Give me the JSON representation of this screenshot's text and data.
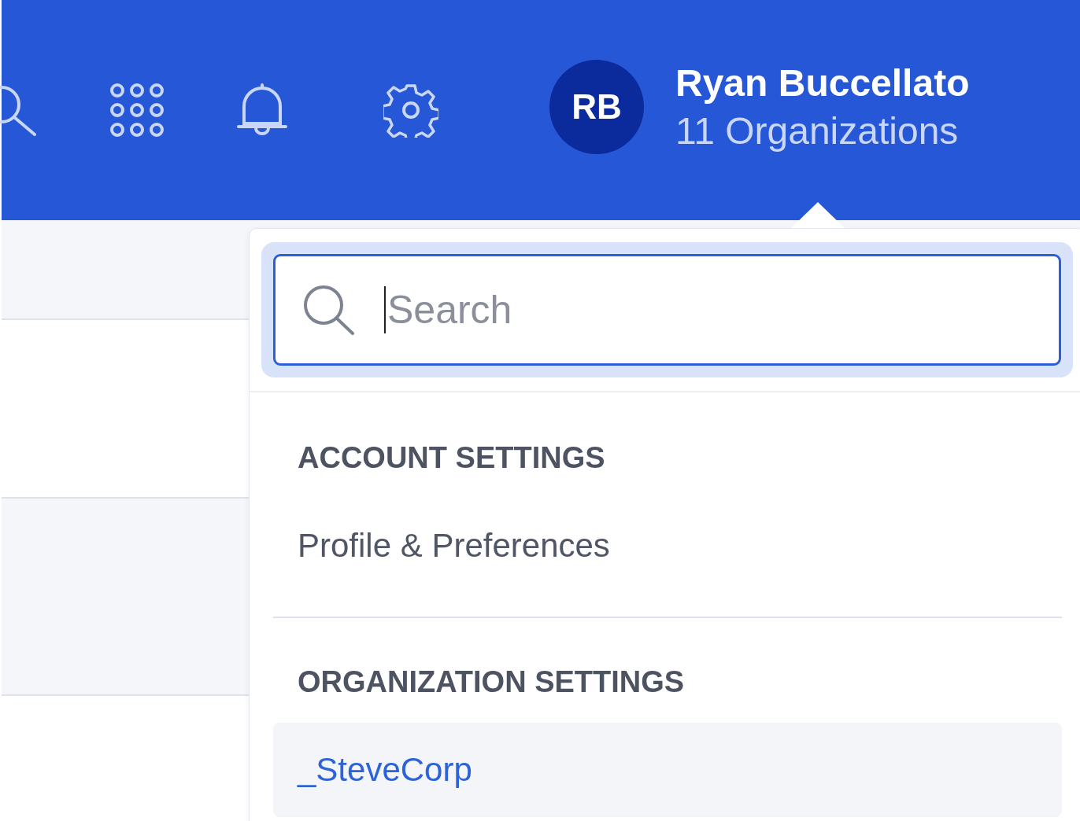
{
  "user": {
    "initials": "RB",
    "name": "Ryan Buccellato",
    "subtitle": "11 Organizations"
  },
  "dropdown": {
    "search": {
      "placeholder": "Search"
    },
    "sections": [
      {
        "heading": "ACCOUNT SETTINGS",
        "items": [
          {
            "label": "Profile & Preferences",
            "selected": false
          }
        ]
      },
      {
        "heading": "ORGANIZATION SETTINGS",
        "items": [
          {
            "label": "_SteveCorp",
            "selected": true
          }
        ]
      }
    ]
  }
}
